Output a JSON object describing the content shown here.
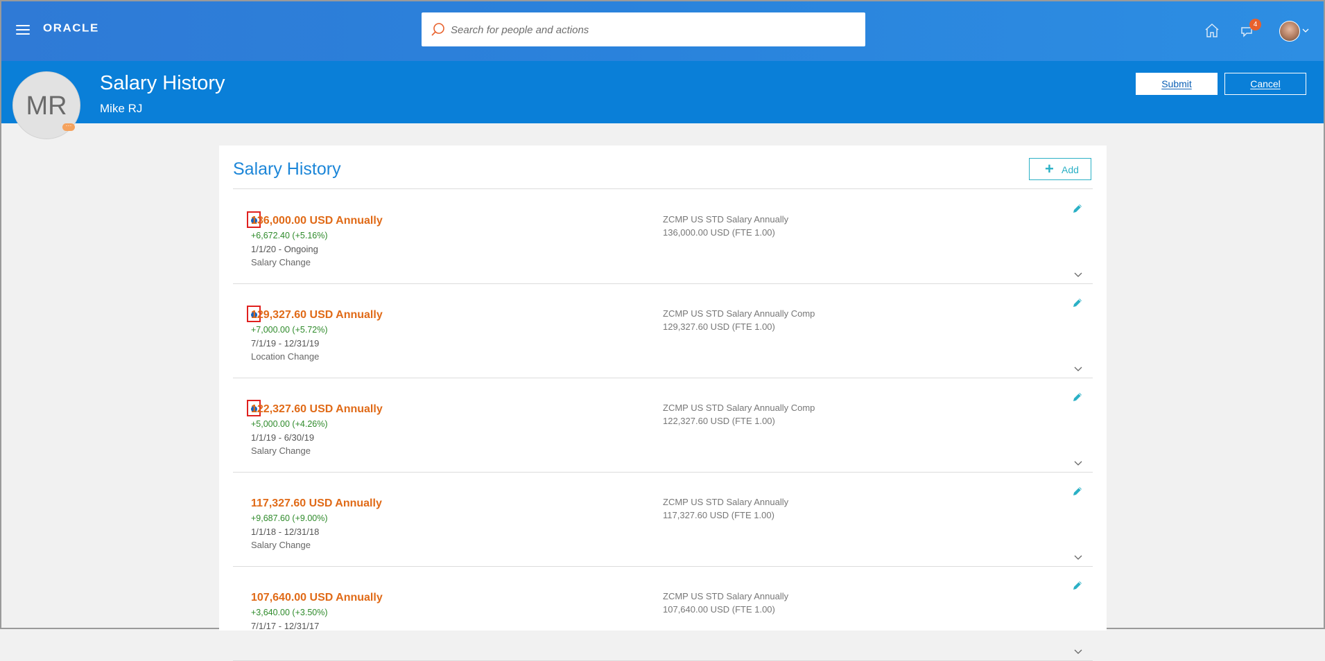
{
  "app": {
    "logo": "ORACLE"
  },
  "search": {
    "placeholder": "Search for people and actions"
  },
  "notifications": {
    "count": "4"
  },
  "header": {
    "initials": "MR",
    "title": "Salary History",
    "person_name": "Mike RJ",
    "submit_label": "Submit",
    "cancel_label": "Cancel"
  },
  "card": {
    "title": "Salary History",
    "add_label": "Add"
  },
  "rows": [
    {
      "amount": "136,000.00 USD Annually",
      "change": "+6,672.40  (+5.16%)",
      "period": "1/1/20 - Ongoing",
      "reason": "Salary Change",
      "plan": "ZCMP US STD Salary Annually",
      "plan_amount": "136,000.00 USD (FTE 1.00)",
      "highlighted": true
    },
    {
      "amount": "129,327.60 USD Annually",
      "change": "+7,000.00  (+5.72%)",
      "period": "7/1/19 - 12/31/19",
      "reason": "Location Change",
      "plan": "ZCMP US STD Salary Annually Comp",
      "plan_amount": "129,327.60 USD (FTE 1.00)",
      "highlighted": true
    },
    {
      "amount": "122,327.60 USD Annually",
      "change": "+5,000.00  (+4.26%)",
      "period": "1/1/19 - 6/30/19",
      "reason": "Salary Change",
      "plan": "ZCMP US STD Salary Annually Comp",
      "plan_amount": "122,327.60 USD (FTE 1.00)",
      "highlighted": true
    },
    {
      "amount": "117,327.60 USD Annually",
      "change": "+9,687.60  (+9.00%)",
      "period": "1/1/18 - 12/31/18",
      "reason": "Salary Change",
      "plan": "ZCMP US STD Salary Annually",
      "plan_amount": "117,327.60 USD (FTE 1.00)",
      "highlighted": false
    },
    {
      "amount": "107,640.00 USD Annually",
      "change": "+3,640.00  (+3.50%)",
      "period": "7/1/17 - 12/31/17",
      "reason": "",
      "plan": "ZCMP US STD Salary Annually",
      "plan_amount": "107,640.00 USD (FTE 1.00)",
      "highlighted": false
    }
  ],
  "colors": {
    "topbar": "#2a83dc",
    "header": "#0a7fd8",
    "amount": "#e06a17",
    "change": "#2e8a2a",
    "accent": "#1c86d8"
  }
}
